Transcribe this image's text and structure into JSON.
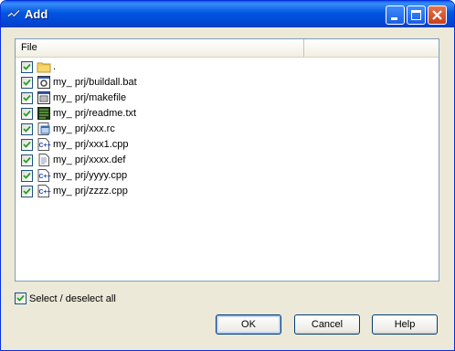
{
  "window": {
    "title": "Add"
  },
  "list": {
    "column_header": "File",
    "items": [
      {
        "name": ".",
        "checked": true,
        "icon": "folder-icon"
      },
      {
        "name": "my_ prj/buildall.bat",
        "checked": true,
        "icon": "batch-file-icon"
      },
      {
        "name": "my_ prj/makefile",
        "checked": true,
        "icon": "makefile-icon"
      },
      {
        "name": "my_ prj/readme.txt",
        "checked": true,
        "icon": "text-file-icon"
      },
      {
        "name": "my_ prj/xxx.rc",
        "checked": true,
        "icon": "resource-file-icon"
      },
      {
        "name": "my_ prj/xxx1.cpp",
        "checked": true,
        "icon": "cpp-file-icon"
      },
      {
        "name": "my_ prj/xxxx.def",
        "checked": true,
        "icon": "def-file-icon"
      },
      {
        "name": "my_ prj/yyyy.cpp",
        "checked": true,
        "icon": "cpp-file-icon"
      },
      {
        "name": "my_ prj/zzzz.cpp",
        "checked": true,
        "icon": "cpp-file-icon"
      }
    ]
  },
  "select_all": {
    "label": "Select / deselect all",
    "checked": true
  },
  "buttons": {
    "ok": "OK",
    "cancel": "Cancel",
    "help": "Help"
  }
}
